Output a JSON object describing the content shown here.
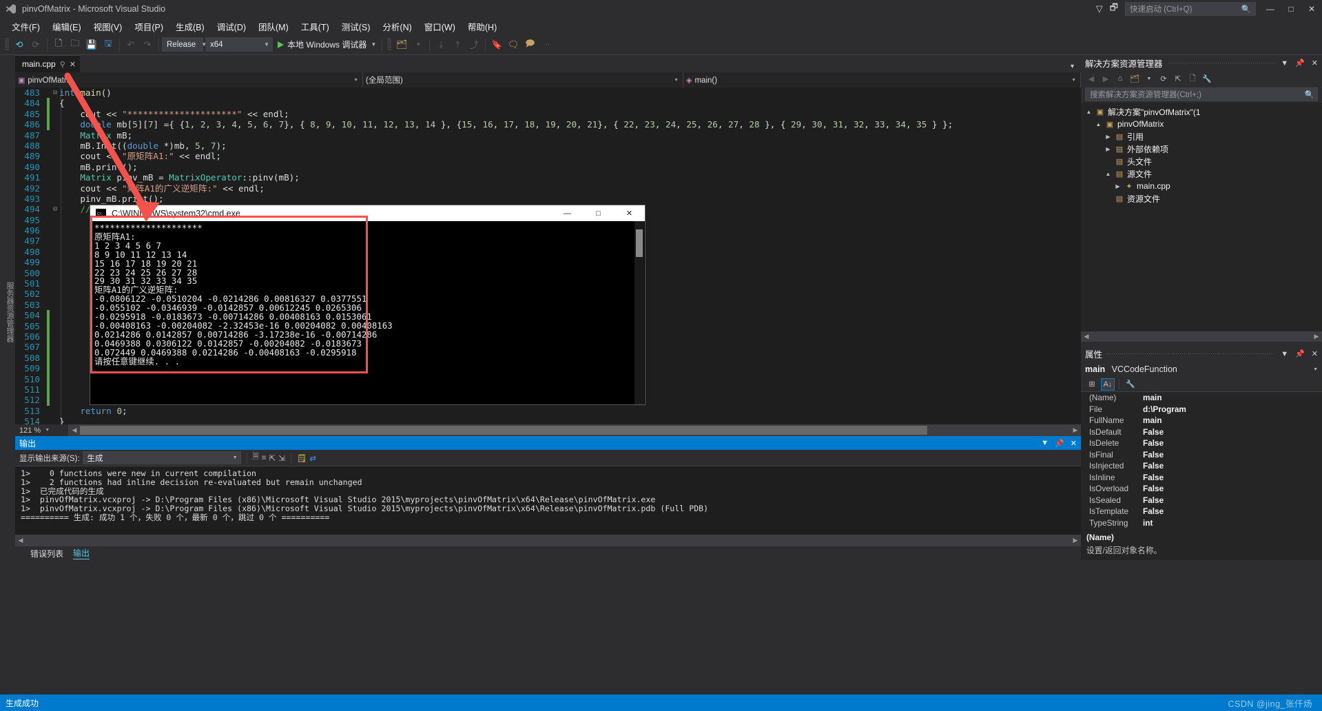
{
  "titlebar": {
    "title": "pinvOfMatrix - Microsoft Visual Studio",
    "quick_launch_placeholder": "快速启动 (Ctrl+Q)",
    "minimize": "—",
    "maximize": "□",
    "close": "✕"
  },
  "menu": [
    {
      "label": "文件(F)"
    },
    {
      "label": "编辑(E)"
    },
    {
      "label": "视图(V)"
    },
    {
      "label": "项目(P)"
    },
    {
      "label": "生成(B)"
    },
    {
      "label": "调试(D)"
    },
    {
      "label": "团队(M)"
    },
    {
      "label": "工具(T)"
    },
    {
      "label": "测试(S)"
    },
    {
      "label": "分析(N)"
    },
    {
      "label": "窗口(W)"
    },
    {
      "label": "帮助(H)"
    }
  ],
  "toolbar": {
    "config": "Release",
    "platform": "x64",
    "run_label": "本地 Windows 调试器"
  },
  "editor": {
    "tab_name": "main.cpp",
    "nav_left": "pinvOfMatrix",
    "nav_mid": "(全局范围)",
    "nav_right": "main()",
    "zoom": "121 %",
    "lines": [
      {
        "no": "483",
        "fold": "⊟",
        "mark": false,
        "html": "<span class='k'>int</span> <span class='f'>main</span>()"
      },
      {
        "no": "484",
        "fold": "",
        "mark": true,
        "html": "{"
      },
      {
        "no": "485",
        "fold": "",
        "mark": true,
        "html": "    cout &lt;&lt; <span class='s'>\"*********************\"</span> &lt;&lt; endl;"
      },
      {
        "no": "486",
        "fold": "",
        "mark": true,
        "html": "    <span class='k'>double</span> mb[<span class='n'>5</span>][<span class='n'>7</span>] ={ {<span class='n'>1</span>, <span class='n'>2</span>, <span class='n'>3</span>, <span class='n'>4</span>, <span class='n'>5</span>, <span class='n'>6</span>, <span class='n'>7</span>}, { <span class='n'>8</span>, <span class='n'>9</span>, <span class='n'>10</span>, <span class='n'>11</span>, <span class='n'>12</span>, <span class='n'>13</span>, <span class='n'>14</span> }, {<span class='n'>15</span>, <span class='n'>16</span>, <span class='n'>17</span>, <span class='n'>18</span>, <span class='n'>19</span>, <span class='n'>20</span>, <span class='n'>21</span>}, { <span class='n'>22</span>, <span class='n'>23</span>, <span class='n'>24</span>, <span class='n'>25</span>, <span class='n'>26</span>, <span class='n'>27</span>, <span class='n'>28</span> }, { <span class='n'>29</span>, <span class='n'>30</span>, <span class='n'>31</span>, <span class='n'>32</span>, <span class='n'>33</span>, <span class='n'>34</span>, <span class='n'>35</span> } };"
      },
      {
        "no": "487",
        "fold": "",
        "mark": false,
        "html": "    <span class='t'>Matrix</span> mB;"
      },
      {
        "no": "488",
        "fold": "",
        "mark": false,
        "html": "    mB.Init((<span class='k'>double</span> *)mb, <span class='n'>5</span>, <span class='n'>7</span>);"
      },
      {
        "no": "489",
        "fold": "",
        "mark": false,
        "html": "    cout &lt;&lt; <span class='s'>\"原矩阵A1:\"</span> &lt;&lt; endl;"
      },
      {
        "no": "490",
        "fold": "",
        "mark": false,
        "html": "    mB.print();"
      },
      {
        "no": "491",
        "fold": "",
        "mark": false,
        "html": "    <span class='t'>Matrix</span> pinv_mB = <span class='t'>MatrixOperator</span>::pinv(mB);"
      },
      {
        "no": "492",
        "fold": "",
        "mark": false,
        "html": "    cout &lt;&lt; <span class='s'>\"矩阵A1的广义逆矩阵:\"</span> &lt;&lt; endl;"
      },
      {
        "no": "493",
        "fold": "",
        "mark": false,
        "html": "    pinv_mB.print();"
      },
      {
        "no": "494",
        "fold": "⊟",
        "mark": false,
        "html": "    <span class='c'>//cout &lt;&lt; \"*********************\" &lt;&lt; endl;</span>"
      },
      {
        "no": "495",
        "fold": "",
        "mark": false,
        "html": ""
      },
      {
        "no": "496",
        "fold": "",
        "mark": false,
        "html": ""
      },
      {
        "no": "497",
        "fold": "",
        "mark": false,
        "html": ""
      },
      {
        "no": "498",
        "fold": "",
        "mark": false,
        "html": ""
      },
      {
        "no": "499",
        "fold": "",
        "mark": false,
        "html": ""
      },
      {
        "no": "500",
        "fold": "",
        "mark": false,
        "html": ""
      },
      {
        "no": "501",
        "fold": "",
        "mark": false,
        "html": ""
      },
      {
        "no": "502",
        "fold": "",
        "mark": false,
        "html": ""
      },
      {
        "no": "503",
        "fold": "",
        "mark": false,
        "html": ""
      },
      {
        "no": "504",
        "fold": "",
        "mark": true,
        "html": ""
      },
      {
        "no": "505",
        "fold": "",
        "mark": true,
        "html": ""
      },
      {
        "no": "506",
        "fold": "",
        "mark": true,
        "html": ""
      },
      {
        "no": "507",
        "fold": "",
        "mark": true,
        "html": ""
      },
      {
        "no": "508",
        "fold": "",
        "mark": true,
        "html": ""
      },
      {
        "no": "509",
        "fold": "",
        "mark": true,
        "html": ""
      },
      {
        "no": "510",
        "fold": "",
        "mark": true,
        "html": ""
      },
      {
        "no": "511",
        "fold": "",
        "mark": true,
        "html": ""
      },
      {
        "no": "512",
        "fold": "",
        "mark": true,
        "html": ""
      },
      {
        "no": "513",
        "fold": "",
        "mark": false,
        "html": "    <span class='k'>return</span> <span class='n'>0</span>;"
      },
      {
        "no": "514",
        "fold": "",
        "mark": false,
        "html": "}"
      }
    ]
  },
  "console": {
    "title": "C:\\WINDOWS\\system32\\cmd.exe",
    "minimize": "—",
    "maximize": "□",
    "close": "✕",
    "text": "*********************\n原矩阵A1:\n1 2 3 4 5 6 7\n8 9 10 11 12 13 14\n15 16 17 18 19 20 21\n22 23 24 25 26 27 28\n29 30 31 32 33 34 35\n矩阵A1的广义逆矩阵:\n-0.0806122 -0.0510204 -0.0214286 0.00816327 0.0377551\n-0.055102 -0.0346939 -0.0142857 0.00612245 0.0265306\n-0.0295918 -0.0183673 -0.00714286 0.00408163 0.0153061\n-0.00408163 -0.00204082 -2.32453e-16 0.00204082 0.00408163\n0.0214286 0.0142857 0.00714286 -3.17238e-16 -0.00714286\n0.0469388 0.0306122 0.0142857 -0.00204082 -0.0183673\n0.072449 0.0469388 0.0214286 -0.00408163 -0.0295918\n请按任意键继续. . ."
  },
  "output": {
    "panel_title": "输出",
    "source_label": "显示输出来源(S):",
    "source_value": "生成",
    "lines": [
      "1>    0 functions were new in current compilation",
      "1>    2 functions had inline decision re-evaluated but remain unchanged",
      "1>  已完成代码的生成",
      "1>  pinvOfMatrix.vcxproj -> D:\\Program Files (x86)\\Microsoft Visual Studio 2015\\myprojects\\pinvOfMatrix\\x64\\Release\\pinvOfMatrix.exe",
      "1>  pinvOfMatrix.vcxproj -> D:\\Program Files (x86)\\Microsoft Visual Studio 2015\\myprojects\\pinvOfMatrix\\x64\\Release\\pinvOfMatrix.pdb (Full PDB)",
      "========== 生成: 成功 1 个，失败 0 个，最新 0 个，跳过 0 个 =========="
    ],
    "bottom_tabs": [
      {
        "label": "错误列表",
        "active": false
      },
      {
        "label": "输出",
        "active": true
      }
    ]
  },
  "solution_explorer": {
    "title": "解决方案资源管理器",
    "search_placeholder": "搜索解决方案资源管理器(Ctrl+;)",
    "tree": [
      {
        "label": "解决方案\"pinvOfMatrix\"(1",
        "indent": 0,
        "expander": "▲",
        "icon": "▣"
      },
      {
        "label": "pinvOfMatrix",
        "indent": 1,
        "expander": "▲",
        "icon": "▣"
      },
      {
        "label": "引用",
        "indent": 2,
        "expander": "▶",
        "icon": "▤"
      },
      {
        "label": "外部依赖项",
        "indent": 2,
        "expander": "▶",
        "icon": "▤"
      },
      {
        "label": "头文件",
        "indent": 2,
        "expander": "",
        "icon": "▤"
      },
      {
        "label": "源文件",
        "indent": 2,
        "expander": "▲",
        "icon": "▤"
      },
      {
        "label": "main.cpp",
        "indent": 3,
        "expander": "▶",
        "icon": "✦"
      },
      {
        "label": "资源文件",
        "indent": 2,
        "expander": "",
        "icon": "▤"
      }
    ]
  },
  "properties": {
    "title": "属性",
    "object": "main",
    "object_type": "VCCodeFunction",
    "rows": [
      {
        "key": "(Name)",
        "value": "main"
      },
      {
        "key": "File",
        "value": "d:\\Program"
      },
      {
        "key": "FullName",
        "value": "main"
      },
      {
        "key": "IsDefault",
        "value": "False"
      },
      {
        "key": "IsDelete",
        "value": "False"
      },
      {
        "key": "IsFinal",
        "value": "False"
      },
      {
        "key": "IsInjected",
        "value": "False"
      },
      {
        "key": "IsInline",
        "value": "False"
      },
      {
        "key": "IsOverload",
        "value": "False"
      },
      {
        "key": "IsSealed",
        "value": "False"
      },
      {
        "key": "IsTemplate",
        "value": "False"
      },
      {
        "key": "TypeString",
        "value": "int"
      }
    ],
    "desc_title": "(Name)",
    "desc_body": "设置/返回对象名称。"
  },
  "statusbar": {
    "text": "生成成功",
    "watermark": "CSDN @jing_张仟炀"
  },
  "left_strip": "服务器资源管理器",
  "icons": {
    "search": "🔍",
    "pin": "📌",
    "close": "✕",
    "chevron_down": "▾",
    "chevron_right": "▸"
  }
}
